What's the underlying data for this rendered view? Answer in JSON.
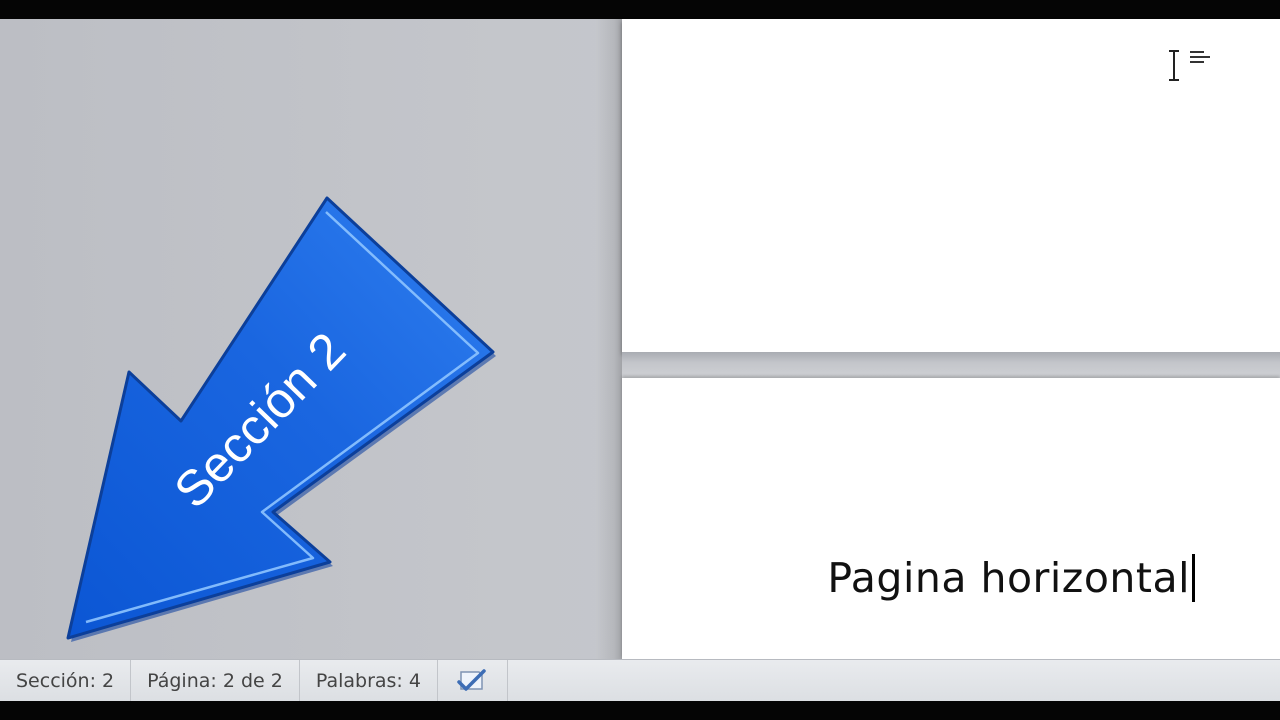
{
  "status_bar": {
    "section": "Sección: 2",
    "page": "Página: 2 de 2",
    "words": "Palabras: 4",
    "proofing_icon": "spell-check-icon"
  },
  "document": {
    "page2_text": "Pagina horizontal"
  },
  "callout": {
    "label": "Sección 2",
    "icon": "arrow-down-left-icon",
    "color": "#1a63d8"
  },
  "cursor": {
    "icon": "text-cursor-icon"
  }
}
